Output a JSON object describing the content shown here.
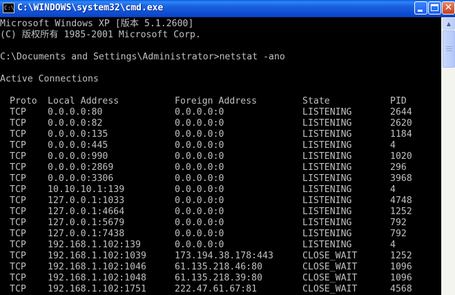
{
  "window": {
    "title": "C:\\WINDOWS\\system32\\cmd.exe",
    "icon": "cmd-icon",
    "icon_text": "C:\\"
  },
  "console": {
    "banner": [
      "Microsoft Windows XP [版本 5.1.2600]",
      "(C) 版权所有 1985-2001 Microsoft Corp."
    ],
    "prompt": "C:\\Documents and Settings\\Administrator>netstat -ano",
    "section": "Active Connections",
    "headers": [
      "Proto",
      "Local Address",
      "Foreign Address",
      "State",
      "PID"
    ],
    "rows": [
      [
        "TCP",
        "0.0.0.0:80",
        "0.0.0.0:0",
        "LISTENING",
        "2644"
      ],
      [
        "TCP",
        "0.0.0.0:82",
        "0.0.0.0:0",
        "LISTENING",
        "2620"
      ],
      [
        "TCP",
        "0.0.0.0:135",
        "0.0.0.0:0",
        "LISTENING",
        "1184"
      ],
      [
        "TCP",
        "0.0.0.0:445",
        "0.0.0.0:0",
        "LISTENING",
        "4"
      ],
      [
        "TCP",
        "0.0.0.0:990",
        "0.0.0.0:0",
        "LISTENING",
        "1020"
      ],
      [
        "TCP",
        "0.0.0.0:2869",
        "0.0.0.0:0",
        "LISTENING",
        "296"
      ],
      [
        "TCP",
        "0.0.0.0:3306",
        "0.0.0.0:0",
        "LISTENING",
        "3968"
      ],
      [
        "TCP",
        "10.10.10.1:139",
        "0.0.0.0:0",
        "LISTENING",
        "4"
      ],
      [
        "TCP",
        "127.0.0.1:1033",
        "0.0.0.0:0",
        "LISTENING",
        "4748"
      ],
      [
        "TCP",
        "127.0.0.1:4664",
        "0.0.0.0:0",
        "LISTENING",
        "1252"
      ],
      [
        "TCP",
        "127.0.0.1:5679",
        "0.0.0.0:0",
        "LISTENING",
        "792"
      ],
      [
        "TCP",
        "127.0.0.1:7438",
        "0.0.0.0:0",
        "LISTENING",
        "792"
      ],
      [
        "TCP",
        "192.168.1.102:139",
        "0.0.0.0:0",
        "LISTENING",
        "4"
      ],
      [
        "TCP",
        "192.168.1.102:1039",
        "173.194.38.178:443",
        "CLOSE_WAIT",
        "1252"
      ],
      [
        "TCP",
        "192.168.1.102:1046",
        "61.135.218.46:80",
        "CLOSE_WAIT",
        "1096"
      ],
      [
        "TCP",
        "192.168.1.102:1048",
        "61.135.218.39:80",
        "CLOSE_WAIT",
        "1096"
      ],
      [
        "TCP",
        "192.168.1.102:1751",
        "222.47.61.67:81",
        "CLOSE_WAIT",
        "4568"
      ]
    ]
  },
  "colors": {
    "console_text": "#c0c0c0",
    "console_background": "#000000",
    "titlebar": "#0f4fd6"
  }
}
